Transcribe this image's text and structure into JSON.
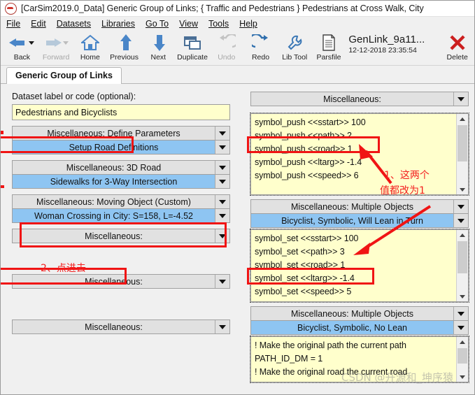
{
  "window": {
    "title": "[CarSim2019.0_Data] Generic Group of Links; { Traffic and Pedestrians } Pedestrians at Cross Walk, City",
    "icon": "carsim-car-icon"
  },
  "menubar": [
    {
      "label": "File"
    },
    {
      "label": "Edit"
    },
    {
      "label": "Datasets"
    },
    {
      "label": "Libraries"
    },
    {
      "label": "Go To"
    },
    {
      "label": "View"
    },
    {
      "label": "Tools"
    },
    {
      "label": "Help"
    }
  ],
  "toolbar": {
    "buttons": [
      {
        "label": "Back",
        "icon": "arrow-left-icon",
        "enabled": true,
        "has_caret": true
      },
      {
        "label": "Forward",
        "icon": "arrow-right-icon",
        "enabled": false,
        "has_caret": true
      },
      {
        "label": "Home",
        "icon": "home-icon",
        "enabled": true
      },
      {
        "label": "Previous",
        "icon": "arrow-up-icon",
        "enabled": true
      },
      {
        "label": "Next",
        "icon": "arrow-down-icon",
        "enabled": true
      },
      {
        "label": "Duplicate",
        "icon": "duplicate-icon",
        "enabled": true
      },
      {
        "label": "Undo",
        "icon": "undo-icon",
        "enabled": false
      },
      {
        "label": "Redo",
        "icon": "redo-icon",
        "enabled": true
      },
      {
        "label": "Lib Tool",
        "icon": "wrench-icon",
        "enabled": true
      },
      {
        "label": "Parsfile",
        "icon": "document-icon",
        "enabled": true
      }
    ],
    "parsfile_name": "GenLink_9a11...",
    "parsfile_date": "12-12-2018 23:35:54",
    "delete_label": "Delete",
    "delete_icon": "x-close-icon"
  },
  "tab": {
    "label": "Generic Group of Links"
  },
  "left": {
    "dataset_label_caption": "Dataset label or code (optional):",
    "dataset_label_value": "Pedestrians and Bicyclists",
    "rows": [
      {
        "category": "Miscellaneous: Define Parameters",
        "selection": "Setup Road Definitions",
        "selected": true
      },
      {
        "category": "Miscellaneous: 3D Road",
        "selection": "Sidewalks for 3-Way Intersection",
        "selected": true
      },
      {
        "category": "Miscellaneous: Moving Object (Custom)",
        "selection": "Woman Crossing in City: S=158, L=-4.52",
        "selected": true
      },
      {
        "category": "Miscellaneous:",
        "selection": null,
        "selected": false
      },
      {
        "category": "Miscellaneous:",
        "selection": null,
        "selected": false
      },
      {
        "category": "Miscellaneous:",
        "selection": null,
        "selected": false
      }
    ]
  },
  "right": {
    "panels": [
      {
        "category": "Miscellaneous:",
        "selection": null,
        "code": [
          "symbol_push <<sstart>> 100",
          "symbol_push <<path>> 2",
          "symbol_push  <<road>> 1",
          "symbol_push <<ltarg>> -1.4",
          "symbol_push <<speed>> 6"
        ]
      },
      {
        "category": "Miscellaneous: Multiple Objects",
        "selection": "Bicyclist, Symbolic, Will Lean in Turn",
        "code": [
          "symbol_set <<sstart>> 100",
          "symbol_set <<path>> 3",
          "symbol_set  <<road>> 1",
          "symbol_set <<ltarg>> -1.4",
          "symbol_set <<speed>> 5"
        ]
      },
      {
        "category": "Miscellaneous: Multiple Objects",
        "selection": "Bicyclist, Symbolic, No Lean",
        "code": [
          "! Make the original path the current path",
          "PATH_ID_DM = 1",
          "! Make the original road the current road"
        ]
      }
    ]
  },
  "annotations": {
    "note1": "1、这两个",
    "note1b": "值都改为1",
    "note2": "2、点进去",
    "watermark": "CSDN @开源和_坤序猿",
    "highlight_color": "#f01414"
  }
}
